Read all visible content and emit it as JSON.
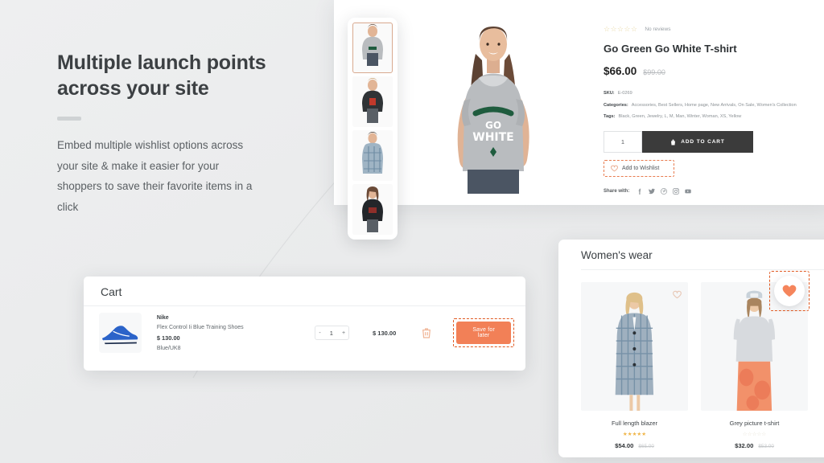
{
  "hero_copy": {
    "heading": "Multiple launch points across your site",
    "body": "Embed multiple wishlist options across your site & make it easier for your shoppers to save their favorite items in a click"
  },
  "product_page": {
    "rating_stars": "☆☆☆☆☆",
    "reviews_text": "No reviews",
    "title": "Go Green Go White T-shirt",
    "price": "$66.00",
    "compare_price": "$99.00",
    "sku_label": "SKU:",
    "sku_value": "E-0269",
    "categories_label": "Categories:",
    "categories_value": "Accessories, Best Sellers, Home page, New Arrivals, On Sale, Women's Collection",
    "tags_label": "Tags:",
    "tags_value": "Black, Green, Jewelry, L, M, Man, Winter, Woman, XS, Yellow",
    "quantity": "1",
    "add_to_cart_label": "ADD TO CART",
    "wishlist_label": "Add to Wishlist",
    "share_label": "Share with:",
    "share_icons": [
      "facebook-icon",
      "twitter-icon",
      "pinterest-icon",
      "instagram-icon",
      "youtube-icon"
    ],
    "thumbnails": [
      "thumb-grey-tee",
      "thumb-black-tee",
      "thumb-plaid-dress",
      "thumb-dark-tee"
    ]
  },
  "cart": {
    "title": "Cart",
    "item": {
      "brand": "Nike",
      "name": "Flex Control Ii Blue Training Shoes",
      "price": "$ 130.00",
      "variant": "Blue/UK8",
      "qty_minus": "-",
      "qty_value": "1",
      "qty_plus": "+",
      "line_total": "$ 130.00",
      "remove_icon": "trash-icon",
      "save_label": "Save for later"
    }
  },
  "womens_wear": {
    "title": "Women's wear",
    "products": [
      {
        "name": "Full length blazer",
        "stars_on": "★★★★★",
        "stars_off": "",
        "price": "$54.00",
        "compare_price": "$65.00",
        "wishlist_state": "outline"
      },
      {
        "name": "Grey picture t-shirt",
        "stars_on": "",
        "stars_off": "☆☆☆☆☆",
        "price": "$32.00",
        "compare_price": "$53.00",
        "wishlist_state": "filled"
      }
    ]
  },
  "colors": {
    "accent_orange": "#f28057",
    "dash_orange": "#e05a22",
    "background": "#eceded",
    "dark_button": "#3b3b3b"
  }
}
